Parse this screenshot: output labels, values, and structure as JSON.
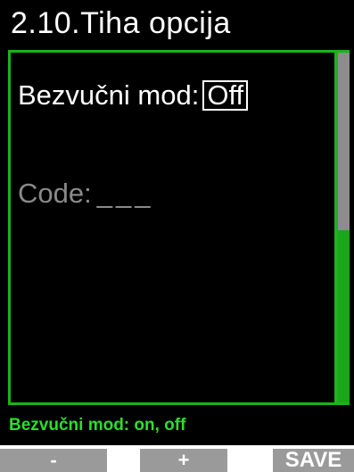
{
  "header": {
    "title": "2.10.Tiha opcija"
  },
  "settings": {
    "silent_mode_label": "Bezvučni mod:",
    "silent_mode_value": "Off",
    "code_label": "Code:",
    "code_value": "___"
  },
  "hint": {
    "text": "Bezvučni mod: on, off"
  },
  "softkeys": {
    "minus": "-",
    "plus": "+",
    "save": "SAVE"
  },
  "colors": {
    "accent_green": "#1db21d",
    "hint_green": "#2fdc2f",
    "scroll_grey": "#8d8d8d"
  }
}
